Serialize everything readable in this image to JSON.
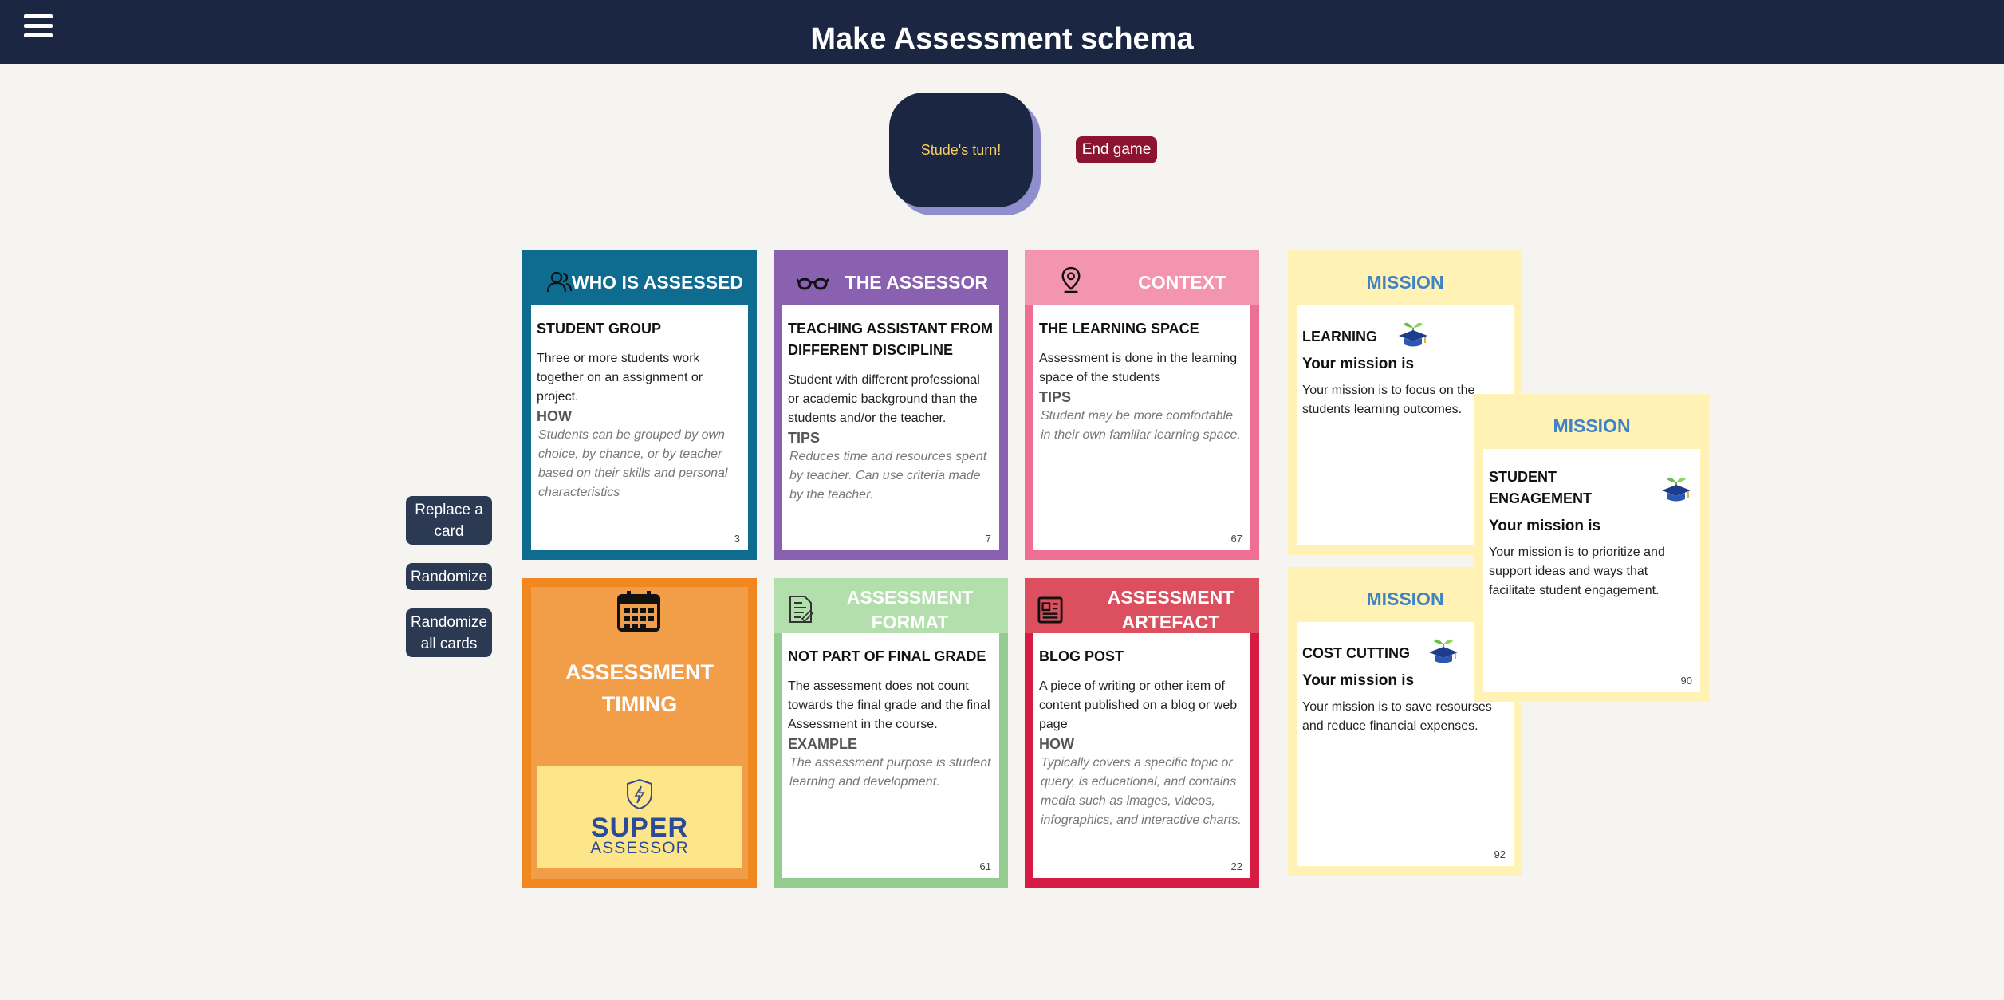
{
  "header": {
    "title": "Make Assessment schema",
    "menu_icon": "hamburger-menu-icon"
  },
  "turn": {
    "label": "Stude's turn!"
  },
  "end_game": {
    "label": "End game"
  },
  "actions": {
    "replace_card": "Replace a card",
    "randomize": "Randomize",
    "randomize_all": "Randomize all cards"
  },
  "colors": {
    "navy": "#1b2642",
    "who_is_assessed": "#0d6c8f",
    "assessor": "#8a60b0",
    "context": "#ee6f93",
    "timing": "#f0881f",
    "format": "#94cc8f",
    "artefact": "#d81b45",
    "mission": "#fff2b4"
  },
  "cards": {
    "who": {
      "header": "WHO IS ASSESSED",
      "icon": "people-icon",
      "title": "STUDENT GROUP",
      "description": "Three or more students work together on an assignment or project.",
      "label": "HOW",
      "note": "Students can be grouped by own choice, by chance, or by teacher based on their skills and personal characteristics",
      "number": "3"
    },
    "assessor": {
      "header": "THE ASSESSOR",
      "icon": "glasses-icon",
      "title": "TEACHING ASSISTANT FROM DIFFERENT DISCIPLINE",
      "description": "Student with different professional or academic background than the students and/or the teacher.",
      "label": "TIPS",
      "note": "Reduces time and resources spent by teacher. Can use criteria made by the teacher.",
      "number": "7"
    },
    "context": {
      "header": "CONTEXT",
      "icon": "location-pin-icon",
      "title": "THE LEARNING SPACE",
      "description": "Assessment is done in the learning space of the students",
      "label": "TIPS",
      "note": "Student may be more comfortable in their own familiar learning space.",
      "number": "67"
    },
    "timing": {
      "header": "ASSESSMENT TIMING",
      "icon": "calendar-icon",
      "logo_top": "SUPER",
      "logo_bottom": "ASSESSOR"
    },
    "format": {
      "header": "ASSESSMENT FORMAT",
      "icon": "document-icon",
      "title": "NOT PART OF FINAL GRADE",
      "description": "The assessment does not count towards the final grade and the final Assessment in the course.",
      "label": "EXAMPLE",
      "note": "The assessment purpose is student learning and development.",
      "number": "61"
    },
    "artefact": {
      "header": "ASSESSMENT ARTEFACT",
      "icon": "newspaper-icon",
      "title": "BLOG POST",
      "description": "A piece of writing or other item of content published on a blog or web page",
      "label": "HOW",
      "note": "Typically covers a specific topic or query, is educational, and contains media such as images, videos, infographics, and interactive charts.",
      "number": "22"
    }
  },
  "missions": [
    {
      "header": "MISSION",
      "title": "LEARNING",
      "subtitle": "Your mission is",
      "description": "Your mission is to focus on the students learning outcomes.",
      "number": ""
    },
    {
      "header": "MISSION",
      "title": "STUDENT ENGAGEMENT",
      "subtitle": "Your mission is",
      "description": "Your mission is to prioritize and support ideas and ways that facilitate student engagement.",
      "number": "90"
    },
    {
      "header": "MISSION",
      "title": "COST CUTTING",
      "subtitle": "Your mission is",
      "description": "Your mission is to save resourses and reduce financial expenses.",
      "number": "92"
    }
  ]
}
